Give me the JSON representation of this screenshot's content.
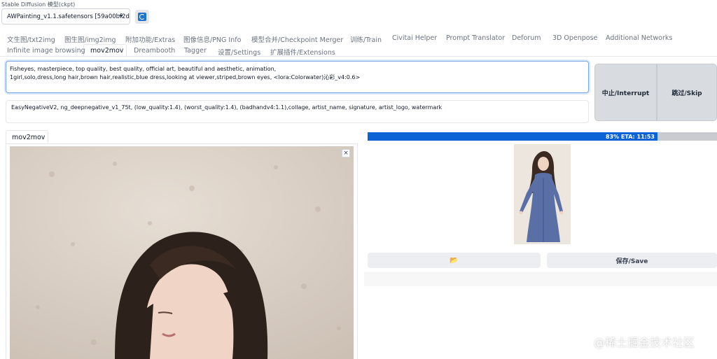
{
  "model": {
    "label": "Stable Diffusion 模型(ckpt)",
    "selected": "AWPainting_v1.1.safetensors [59a00bf2d("
  },
  "tabs_row1": [
    "文生图/txt2img",
    "图生图/img2img",
    "附加功能/Extras",
    "图像信息/PNG Info",
    "模型合并/Checkpoint Merger",
    "训练/Train",
    "Civitai Helper",
    "Prompt Translator",
    "Deforum",
    "3D Openpose",
    "Additional Networks"
  ],
  "tabs_row2": [
    "Infinite image browsing",
    "mov2mov",
    "Dreambooth",
    "Tagger",
    "设置/Settings",
    "扩展插件/Extensions"
  ],
  "active_tab": "mov2mov",
  "prompt": {
    "line1": "Fisheyes, masterpiece, top quality, best quality, official art, beautiful and aesthetic, animation,",
    "line2": "1girl,solo,dress,long hair,brown hair,realistic,blue dress,looking at viewer,striped,brown eyes, <lora:Colorwater)沁彩_v4:0.6>"
  },
  "negative_prompt": "EasyNegativeV2, ng_deepnegative_v1_75t, (low_quality:1.4), (worst_quality:1.4), (badhandv4:1.1),collage, artist_name, signature, artist_logo, watermark",
  "buttons": {
    "interrupt": "中止/Interrupt",
    "skip": "跳过/Skip",
    "save": "保存/Save",
    "folder_icon": "📂"
  },
  "left_panel": {
    "tab_label": "mov2mov",
    "close_symbol": "×"
  },
  "progress": {
    "percent": 83,
    "text": "83% ETA: 11:53"
  },
  "watermark": "@稀土掘金技术社区",
  "colors": {
    "accent": "#0b63d6",
    "focus_border": "#7aa7e8"
  }
}
